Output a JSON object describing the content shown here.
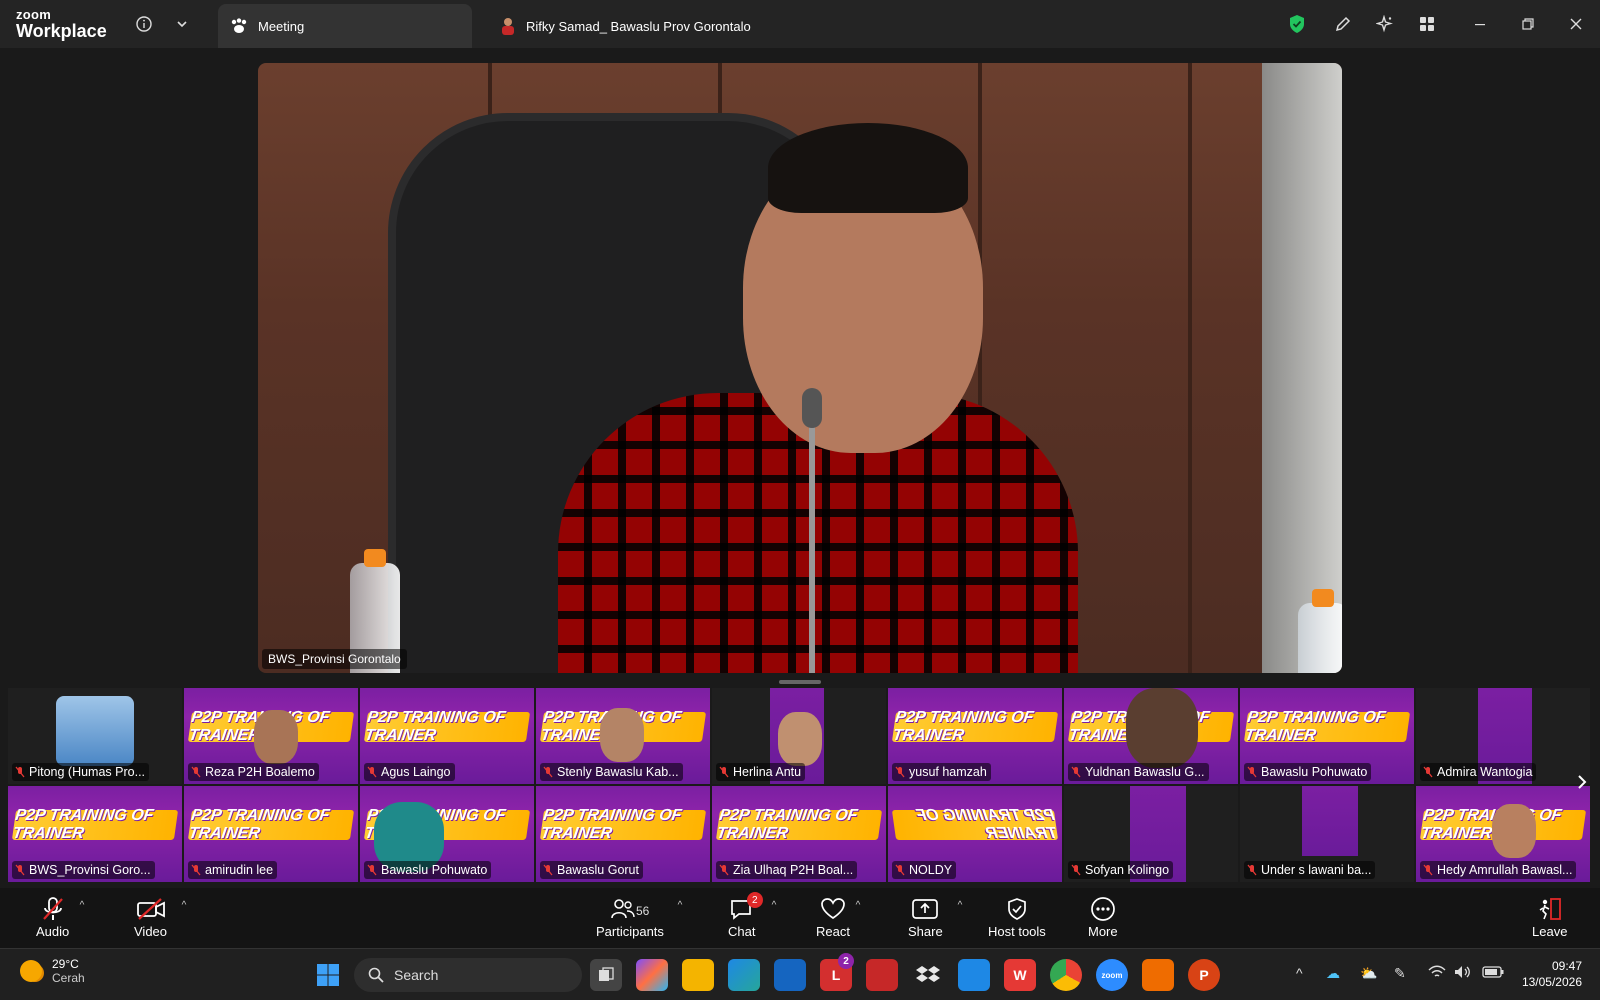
{
  "app": {
    "brand_top": "zoom",
    "brand_bottom": "Workplace"
  },
  "tabs": [
    {
      "label": "Meeting"
    },
    {
      "label": "Rifky Samad_ Bawaslu Prov Gorontalo"
    }
  ],
  "speaker": {
    "name": "BWS_Provinsi Gorontalo"
  },
  "banner_text": "P2P TRAINING OF TRAINER",
  "participants_row1": [
    {
      "name": "Pitong (Humas Pro...",
      "type": "photo"
    },
    {
      "name": "Reza P2H Boalemo",
      "type": "banner"
    },
    {
      "name": "Agus Laingo",
      "type": "banner"
    },
    {
      "name": "Stenly Bawaslu Kab...",
      "type": "banner"
    },
    {
      "name": "Herlina Antu",
      "type": "banner-narrow"
    },
    {
      "name": "yusuf hamzah",
      "type": "banner"
    },
    {
      "name": "Yuldnan Bawaslu G...",
      "type": "banner"
    },
    {
      "name": "Bawaslu Pohuwato",
      "type": "banner"
    },
    {
      "name": "Admira Wantogia",
      "type": "banner-narrow"
    }
  ],
  "participants_row2": [
    {
      "name": "BWS_Provinsi Goro...",
      "type": "banner"
    },
    {
      "name": "amirudin lee",
      "type": "banner"
    },
    {
      "name": "Bawaslu Pohuwato",
      "type": "banner"
    },
    {
      "name": "Bawaslu Gorut",
      "type": "banner"
    },
    {
      "name": "Zia Ulhaq P2H Boal...",
      "type": "banner"
    },
    {
      "name": "NOLDY",
      "type": "banner"
    },
    {
      "name": "Sofyan Kolingo",
      "type": "banner-narrow"
    },
    {
      "name": "Under s lawani ba...",
      "type": "banner-narrow"
    },
    {
      "name": "Hedy Amrullah Bawasl...",
      "type": "banner"
    }
  ],
  "toolbar": {
    "audio": "Audio",
    "video": "Video",
    "participants": "Participants",
    "participants_count": "56",
    "chat": "Chat",
    "chat_badge": "2",
    "react": "React",
    "share": "Share",
    "host_tools": "Host tools",
    "more": "More",
    "leave": "Leave"
  },
  "taskbar": {
    "temp": "29°C",
    "weather": "Cerah",
    "search_placeholder": "Search",
    "app_badge": "2",
    "time": "09:47",
    "date": "13/05/2026"
  },
  "colors": {
    "accent_red": "#e02828",
    "banner_purple": "#7b1fa2",
    "banner_yellow": "#ffc107",
    "shield_green": "#22c55e"
  }
}
